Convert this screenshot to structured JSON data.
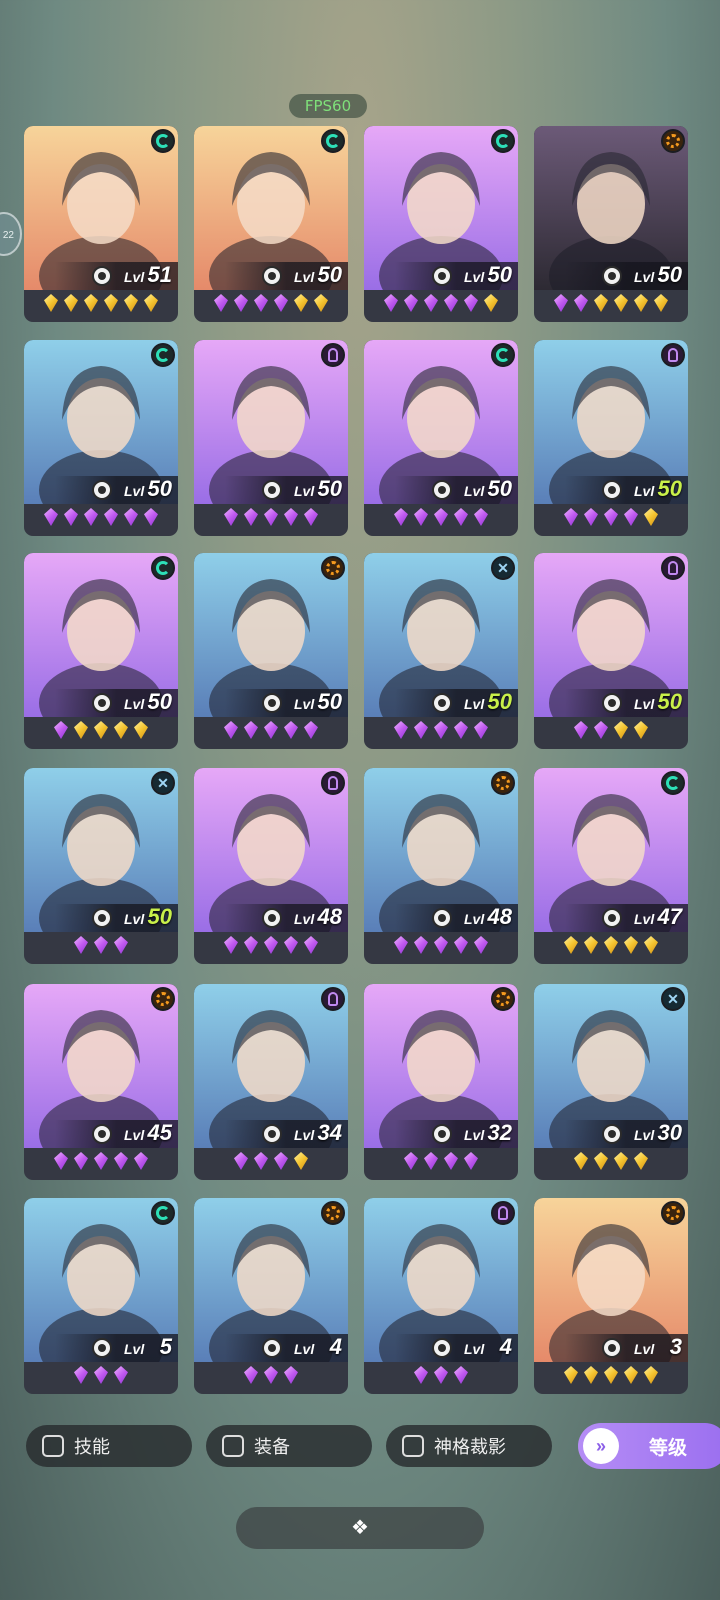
{
  "status": {
    "fps": "FPS60",
    "side_badge": "22"
  },
  "lvl_label": "Lvl",
  "colors": {
    "purple_bg": "#c58ef0",
    "blue_bg": "#7fb3d8",
    "orange_bg": "#f3b07a",
    "accent": "#a77cf2"
  },
  "heroes": [
    {
      "level": "51",
      "role": "control",
      "stars": [
        "gold",
        "gold",
        "gold",
        "gold",
        "gold",
        "gold"
      ],
      "bg": "orange"
    },
    {
      "level": "50",
      "role": "control",
      "stars": [
        "purple",
        "purple",
        "purple",
        "purple",
        "gold",
        "gold"
      ],
      "bg": "orange"
    },
    {
      "level": "50",
      "role": "control",
      "stars": [
        "purple",
        "purple",
        "purple",
        "purple",
        "purple",
        "gold"
      ],
      "bg": "purple"
    },
    {
      "level": "50",
      "role": "war",
      "stars": [
        "purple",
        "purple",
        "gold",
        "gold",
        "gold",
        "gold"
      ],
      "bg": "dark"
    },
    {
      "level": "50",
      "role": "control",
      "stars": [
        "purple",
        "purple",
        "purple",
        "purple",
        "purple",
        "purple"
      ],
      "bg": "blue"
    },
    {
      "level": "50",
      "role": "mage",
      "stars": [
        "purple",
        "purple",
        "purple",
        "purple",
        "purple"
      ],
      "bg": "purple"
    },
    {
      "level": "50",
      "role": "control",
      "stars": [
        "purple",
        "purple",
        "purple",
        "purple",
        "purple"
      ],
      "bg": "purple"
    },
    {
      "level": "50",
      "role": "mage",
      "stars": [
        "purple",
        "purple",
        "purple",
        "purple",
        "gold"
      ],
      "bg": "blue",
      "max": true
    },
    {
      "level": "50",
      "role": "control",
      "stars": [
        "purple",
        "gold",
        "gold",
        "gold",
        "gold"
      ],
      "bg": "purple"
    },
    {
      "level": "50",
      "role": "war",
      "stars": [
        "purple",
        "purple",
        "purple",
        "purple",
        "purple"
      ],
      "bg": "blue"
    },
    {
      "level": "50",
      "role": "assassin",
      "stars": [
        "purple",
        "purple",
        "purple",
        "purple",
        "purple"
      ],
      "bg": "blue",
      "max": true
    },
    {
      "level": "50",
      "role": "mage",
      "stars": [
        "purple",
        "purple",
        "gold",
        "gold"
      ],
      "bg": "purple",
      "max": true
    },
    {
      "level": "50",
      "role": "assassin",
      "stars": [
        "purple",
        "purple",
        "purple"
      ],
      "bg": "blue",
      "max": true
    },
    {
      "level": "48",
      "role": "mage",
      "stars": [
        "purple",
        "purple",
        "purple",
        "purple",
        "purple"
      ],
      "bg": "purple"
    },
    {
      "level": "48",
      "role": "war",
      "stars": [
        "purple",
        "purple",
        "purple",
        "purple",
        "purple"
      ],
      "bg": "blue"
    },
    {
      "level": "47",
      "role": "control",
      "stars": [
        "gold",
        "gold",
        "gold",
        "gold",
        "gold"
      ],
      "bg": "purple"
    },
    {
      "level": "45",
      "role": "war",
      "stars": [
        "purple",
        "purple",
        "purple",
        "purple",
        "purple"
      ],
      "bg": "purple"
    },
    {
      "level": "34",
      "role": "mage",
      "stars": [
        "purple",
        "purple",
        "purple",
        "gold"
      ],
      "bg": "blue"
    },
    {
      "level": "32",
      "role": "war",
      "stars": [
        "purple",
        "purple",
        "purple",
        "purple"
      ],
      "bg": "purple"
    },
    {
      "level": "30",
      "role": "assassin",
      "stars": [
        "gold",
        "gold",
        "gold",
        "gold"
      ],
      "bg": "blue"
    },
    {
      "level": "5",
      "role": "control",
      "stars": [
        "purple",
        "purple",
        "purple"
      ],
      "bg": "blue"
    },
    {
      "level": "4",
      "role": "war",
      "stars": [
        "purple",
        "purple",
        "purple"
      ],
      "bg": "blue"
    },
    {
      "level": "4",
      "role": "mage",
      "stars": [
        "purple",
        "purple",
        "purple"
      ],
      "bg": "blue"
    },
    {
      "level": "3",
      "role": "war",
      "stars": [
        "gold",
        "gold",
        "gold",
        "gold",
        "gold"
      ],
      "bg": "orange"
    }
  ],
  "filters": [
    {
      "label": "技能"
    },
    {
      "label": "装备"
    },
    {
      "label": "神格裁影"
    }
  ],
  "sort_button": {
    "label": "等级",
    "icon": "chevron-double-down-icon"
  },
  "handle_icon": "expand-grid-icon"
}
